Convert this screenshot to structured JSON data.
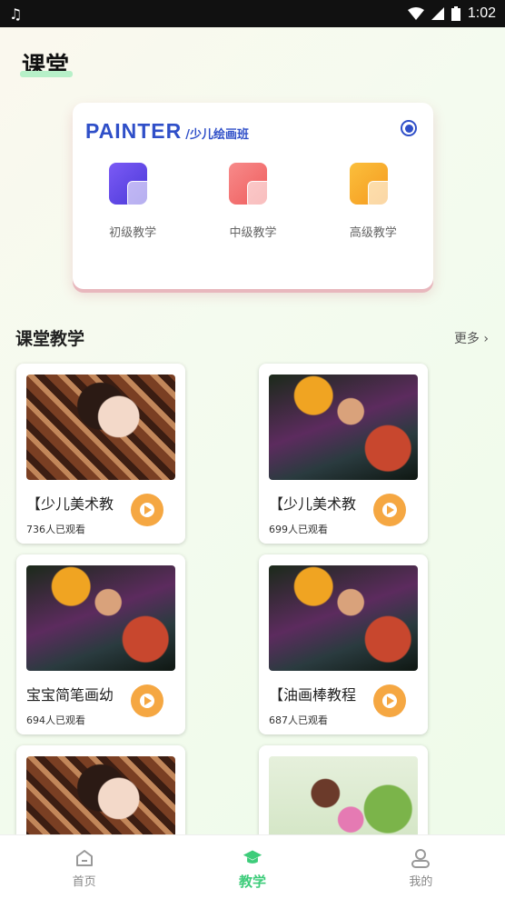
{
  "status_bar": {
    "time": "1:02"
  },
  "header": {
    "title": "课堂"
  },
  "brand_card": {
    "brand": "PAINTER",
    "subtitle": "/少儿绘画班",
    "levels": [
      {
        "label": "初级教学",
        "color": "#6b4cf0"
      },
      {
        "label": "中级教学",
        "color": "#f36b6b"
      },
      {
        "label": "高级教学",
        "color": "#f7a42a"
      }
    ]
  },
  "section": {
    "title": "课堂教学",
    "more": "更多 ›"
  },
  "courses": [
    {
      "title": "【少儿美术教",
      "views": "736人已观看"
    },
    {
      "title": "【少儿美术教",
      "views": "699人已观看"
    },
    {
      "title": "宝宝简笔画幼",
      "views": "694人已观看"
    },
    {
      "title": "【油画棒教程",
      "views": "687人已观看"
    },
    {
      "title": "",
      "views": ""
    },
    {
      "title": "",
      "views": ""
    }
  ],
  "tab_bar": {
    "items": [
      {
        "label": "首页",
        "icon": "home-icon"
      },
      {
        "label": "教学",
        "icon": "graduation-cap-icon"
      },
      {
        "label": "我的",
        "icon": "user-icon"
      }
    ],
    "active": "教学"
  }
}
